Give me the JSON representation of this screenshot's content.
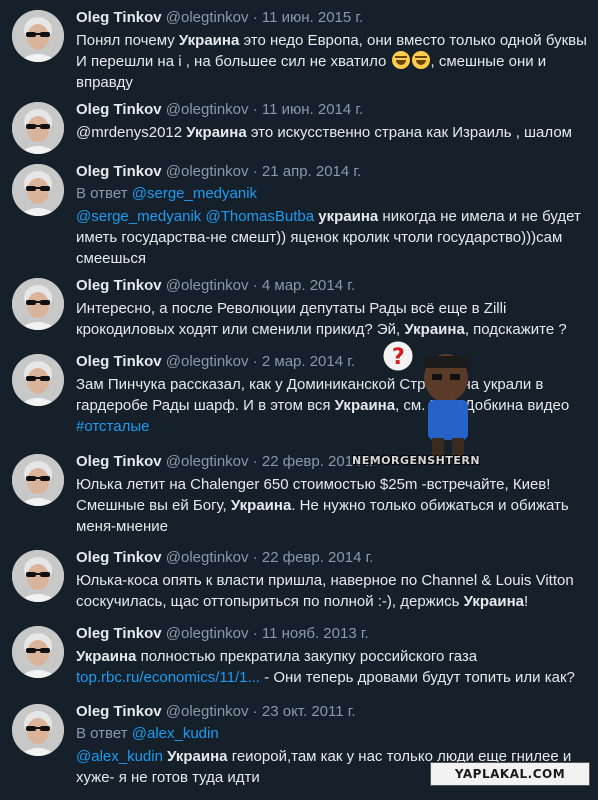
{
  "colors": {
    "background": "#15202b",
    "text": "#e7e9ea",
    "muted": "#8b98a5",
    "link": "#1d9bf0"
  },
  "tweets": [
    {
      "name": "Oleg Tinkov",
      "handle": "@olegtinkov",
      "dot": "·",
      "date": "11 июн. 2015 г.",
      "parts": [
        {
          "t": "Понял почему "
        },
        {
          "t": "Украина",
          "bold": true
        },
        {
          "t": " это недо Европа, они вместо только одной буквы И перешли на і , на большее сил не хватило "
        },
        {
          "emoji": "joy-emoji"
        },
        {
          "emoji": "joy-emoji"
        },
        {
          "t": ", смешные они и вправду"
        }
      ]
    },
    {
      "name": "Oleg Tinkov",
      "handle": "@olegtinkov",
      "dot": "·",
      "date": "11 июн. 2014 г.",
      "parts": [
        {
          "t": "@mrdenys2012 "
        },
        {
          "t": "Украина",
          "bold": true
        },
        {
          "t": " это искусственно страна как Израиль , шалом"
        }
      ]
    },
    {
      "name": "Oleg Tinkov",
      "handle": "@olegtinkov",
      "dot": "·",
      "date": "21 апр. 2014 г.",
      "reply_prefix": "В ответ",
      "reply_to": "@serge_medyanik",
      "parts": [
        {
          "t": "@serge_medyanik",
          "link": true
        },
        {
          "t": " "
        },
        {
          "t": "@ThomasButba",
          "link": true
        },
        {
          "t": " "
        },
        {
          "t": "украина",
          "bold": true
        },
        {
          "t": " никогда не имела и не будет иметь государства-не смешт)) яценок кролик чтоли государство)))сам смеешься"
        }
      ]
    },
    {
      "name": "Oleg Tinkov",
      "handle": "@olegtinkov",
      "dot": "·",
      "date": "4 мар. 2014 г.",
      "parts": [
        {
          "t": "Интересно, а после Революции депутаты Рады всё еще в Zilli крокодиловых ходят или сменили прикид? Эй, "
        },
        {
          "t": "Украина",
          "bold": true
        },
        {
          "t": ", подскажите ?"
        }
      ]
    },
    {
      "name": "Oleg Tinkov",
      "handle": "@olegtinkov",
      "dot": "·",
      "date": "2 мар. 2014 г.",
      "parts": [
        {
          "t": "Зам Пинчука рассказал, как у Доминиканской Строс Кана украли в гардеробе Рады шарф. И в этом вся "
        },
        {
          "t": "Украина",
          "bold": true
        },
        {
          "t": ", см. Ещё Добкина видео "
        },
        {
          "t": "#отсталые",
          "link": true
        }
      ]
    },
    {
      "name": "Oleg Tinkov",
      "handle": "@olegtinkov",
      "dot": "·",
      "date": "22 февр. 2014 г.",
      "parts": [
        {
          "t": "Юлька летит на Chalenger 650 стоимостью $25m -встречайте, Киев! Смешные вы ей Богу, "
        },
        {
          "t": "Украина",
          "bold": true
        },
        {
          "t": ". Не нужно только обижаться и обижать меня-мнение"
        }
      ]
    },
    {
      "name": "Oleg Tinkov",
      "handle": "@olegtinkov",
      "dot": "·",
      "date": "22 февр. 2014 г.",
      "parts": [
        {
          "t": "Юлька-коса опять к власти пришла, наверное по Channel & Louis Vitton соскучилась, щас оттопыриться по полной :-), держись "
        },
        {
          "t": "Украина",
          "bold": true
        },
        {
          "t": "!"
        }
      ]
    },
    {
      "name": "Oleg Tinkov",
      "handle": "@olegtinkov",
      "dot": "·",
      "date": "11 нояб. 2013 г.",
      "parts": [
        {
          "t": "Украина",
          "bold": true
        },
        {
          "t": " полностью прекратила закупку российского газа "
        },
        {
          "t": "top.rbc.ru/economics/11/1...",
          "link": true
        },
        {
          "t": " - Они теперь дровами будут топить или как?"
        }
      ]
    },
    {
      "name": "Oleg Tinkov",
      "handle": "@olegtinkov",
      "dot": "·",
      "date": "23 окт. 2011 г.",
      "reply_prefix": "В ответ",
      "reply_to": "@alex_kudin",
      "parts": [
        {
          "t": "@alex_kudin",
          "link": true
        },
        {
          "t": " "
        },
        {
          "t": "Украина",
          "bold": true
        },
        {
          "t": " геиорой,там как у нас только люди еще гнилее и хуже- я не готов туда идти"
        }
      ]
    }
  ],
  "watermarks": {
    "nemorgenshtern": "NEMORGENSHTERN",
    "yaplakal": "YAPLAKAL.COM"
  }
}
